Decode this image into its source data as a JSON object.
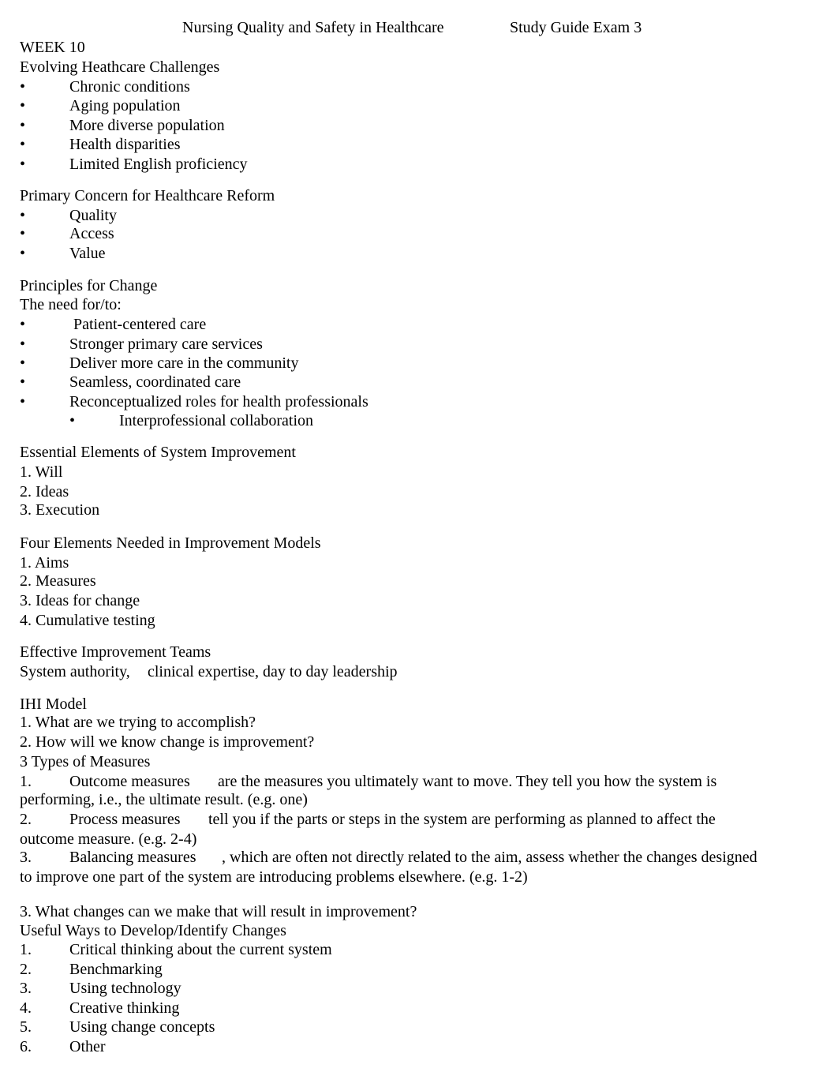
{
  "header": {
    "course_title": "Nursing Quality and Safety in Healthcare",
    "doc_title": "Study Guide Exam 3"
  },
  "week": "WEEK 10",
  "sections": {
    "challenges": {
      "heading": "Evolving Heathcare Challenges",
      "items": [
        "Chronic conditions",
        "Aging population",
        "More diverse population",
        "Health disparities",
        "Limited English proficiency"
      ]
    },
    "reform": {
      "heading": "Primary Concern for Healthcare Reform",
      "items": [
        "Quality",
        "Access",
        "Value"
      ]
    },
    "principles": {
      "heading": "Principles for Change",
      "intro": "The need for/to:",
      "items": [
        "Patient-centered care",
        "Stronger primary care services",
        "Deliver more care in the community",
        "Seamless, coordinated care",
        "Reconceptualized roles for health professionals"
      ],
      "subitems": [
        "Interprofessional collaboration"
      ]
    },
    "essential": {
      "heading": "Essential Elements of System Improvement",
      "items": [
        "1. Will",
        "2. Ideas",
        "3. Execution"
      ]
    },
    "four_elements": {
      "heading": "Four Elements Needed in Improvement Models",
      "items": [
        "1. Aims",
        "2. Measures",
        "3. Ideas for change",
        "4. Cumulative testing"
      ]
    },
    "teams": {
      "heading": "Effective Improvement Teams",
      "text_a": "System authority,",
      "text_b": "clinical expertise, day to day leadership"
    },
    "ihi": {
      "heading": "IHI Model",
      "q1": "1. What are we trying to accomplish?",
      "q2": "2. How will we know change is improvement?",
      "measures_heading": "3 Types of Measures",
      "measures": [
        {
          "num": "1.",
          "term": "Outcome measures",
          "line1": "are the measures you ultimately want to move. They tell you how the system is",
          "line2": "performing, i.e., the ultimate result. (e.g. one)"
        },
        {
          "num": "2.",
          "term": "Process measures",
          "line1": "tell you if the parts or steps in the system are performing as planned to affect the",
          "line2": "outcome measure. (e.g. 2-4)"
        },
        {
          "num": "3.",
          "term": "Balancing measures",
          "line1": ", which are often not directly related to the aim, assess whether the changes designed",
          "line2": "to improve one part of the system are introducing problems elsewhere. (e.g. 1-2)"
        }
      ],
      "q3": "3. What changes can we make that will result in improvement?",
      "ways_heading": "Useful Ways to Develop/Identify Changes",
      "ways": [
        {
          "num": "1.",
          "text": "Critical thinking about the current system"
        },
        {
          "num": "2.",
          "text": "Benchmarking"
        },
        {
          "num": "3.",
          "text": "Using technology"
        },
        {
          "num": "4.",
          "text": "Creative thinking"
        },
        {
          "num": "5.",
          "text": "Using change concepts"
        },
        {
          "num": "6.",
          "text": "Other"
        }
      ]
    }
  },
  "bullet_glyph": "•"
}
